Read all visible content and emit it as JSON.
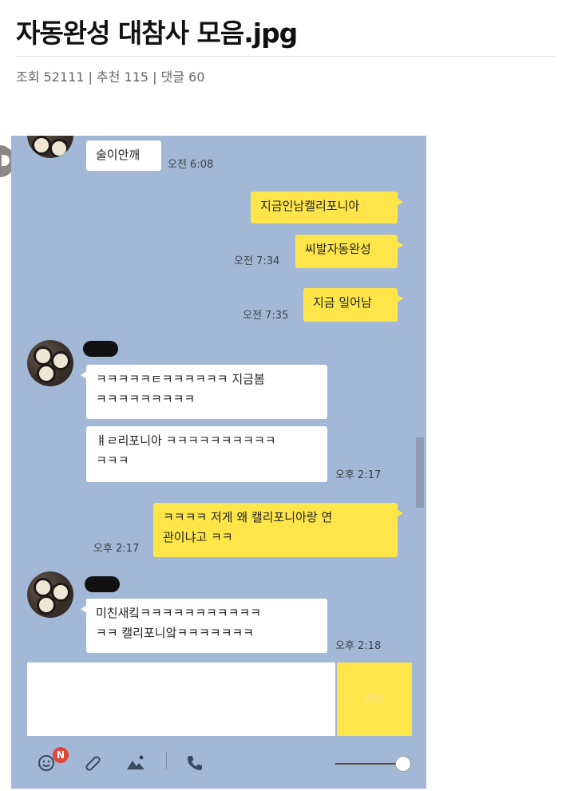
{
  "post": {
    "title": "자동완성 대참사 모음.jpg",
    "meta": "조회 52111 | 추천 115 | 댓글 60"
  },
  "chat": {
    "messages": [
      {
        "side": "in",
        "text": "술이안깨",
        "time": "오전 6:08"
      },
      {
        "side": "out",
        "text": "지금인남캘리포니아",
        "time": ""
      },
      {
        "side": "out",
        "text": "씨발자동완성",
        "time": "오전 7:34"
      },
      {
        "side": "out",
        "text": "지금 일어남",
        "time": "오전 7:35"
      },
      {
        "side": "in",
        "text": "ㅋㅋㅋㅋㅋㅌㅋㅋㅋㅋㅋㅋ 지금봄\nㅋㅋㅋㅋㅋㅋㅋㅋㅋ",
        "time": ""
      },
      {
        "side": "in",
        "text": "ㅒㄹ리포니아 ㅋㅋㅋㅋㅋㅋㅋㅋㅋㅋ\nㅋㅋㅋ",
        "time": "오후 2:17"
      },
      {
        "side": "out",
        "text": "ㅋㅋㅋㅋ 저게 왜 캘리포니아랑 연\n관이냐고 ㅋㅋ",
        "time": "오후 2:17"
      },
      {
        "side": "in",
        "text": "미친새킼ㅋㅋㅋㅋㅋㅋㅋㅋㅋㅋㅋ\nㅋㅋ 캘리포니앜ㅋㅋㅋㅋㅋㅋㅋ",
        "time": "오후 2:18"
      }
    ],
    "send_label": "전송",
    "emoji_badge": "N",
    "colors": {
      "background": "#a3b8d6",
      "outgoing": "#fee64a",
      "incoming": "#ffffff"
    },
    "toolbar_icons": [
      "emoticon-icon",
      "attachment-icon",
      "photo-icon",
      "phone-icon"
    ]
  }
}
